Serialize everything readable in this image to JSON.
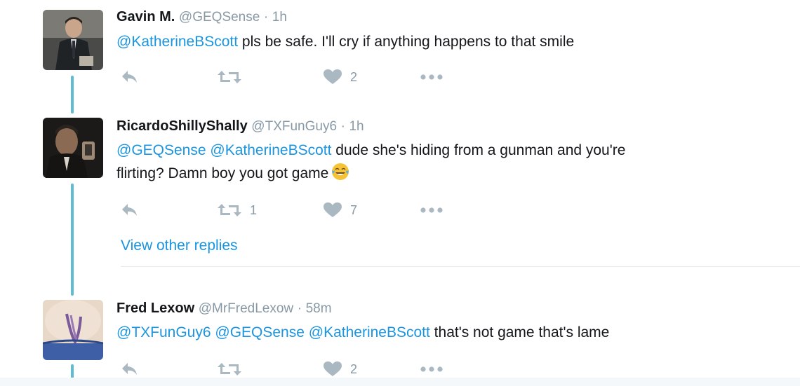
{
  "tweets": [
    {
      "name": "Gavin M.",
      "handle": "@GEQSense",
      "separator": "·",
      "time": "1h",
      "mentions": [
        "@KatherineBScott"
      ],
      "text": " pls be safe. I'll cry if anything happens to that smile",
      "text_line2": "",
      "retweets": "",
      "likes": "2"
    },
    {
      "name": "RicardoShillyShally",
      "handle": "@TXFunGuy6",
      "separator": "·",
      "time": "1h",
      "mentions": [
        "@GEQSense",
        "@KatherineBScott"
      ],
      "text": " dude she's hiding from a gunman and you're",
      "text_line2": "flirting? Damn boy you got game",
      "retweets": "1",
      "likes": "7"
    },
    {
      "name": "Fred Lexow",
      "handle": "@MrFredLexow",
      "separator": "·",
      "time": "58m",
      "mentions": [
        "@TXFunGuy6",
        "@GEQSense",
        "@KatherineBScott"
      ],
      "text": " that's not game that's lame",
      "text_line2": "",
      "retweets": "",
      "likes": "2"
    }
  ],
  "view_other_replies": "View other replies",
  "icons": {
    "reply": "reply-icon",
    "retweet": "retweet-icon",
    "like": "heart-icon",
    "more": "more-icon",
    "emoji": "tears-of-joy-emoji"
  },
  "colors": {
    "link": "#1b95e0",
    "muted": "#8899a6",
    "icon": "#aab8c2",
    "thread": "#5fbcd3"
  }
}
